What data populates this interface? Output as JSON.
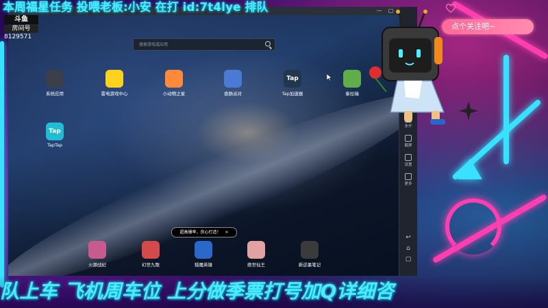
{
  "marquee_top": "本周福星任务 投喂老板:小安 在打 id:7t4lye  排队",
  "marquee_bottom": "队上车  飞机周车位  上分做季票打号加Q详细咨",
  "room": {
    "logo": "斗鱼",
    "label": "房间号",
    "number": "8129571"
  },
  "emulator": {
    "title": "",
    "search_placeholder": "搜索游戏或应用",
    "apps_top": [
      {
        "label": "系统应用",
        "icon": "grid-icon",
        "color": "#3a3f4a",
        "glyph": ""
      },
      {
        "label": "雷电游戏中心",
        "icon": "gamepad-icon",
        "color": "#ffd21f",
        "glyph": ""
      },
      {
        "label": "小动物之星",
        "icon": "fox-icon",
        "color": "#ff8a3c",
        "glyph": ""
      },
      {
        "label": "香肠派对",
        "icon": "character-icon",
        "color": "#4b7ad6",
        "glyph": ""
      },
      {
        "label": "Tap加速器",
        "icon": "tap-accelerator-icon",
        "color": "#22364e",
        "glyph": "Tap"
      },
      {
        "label": "泰拉瑞",
        "icon": "terraria-icon",
        "color": "#5fae4a",
        "glyph": ""
      }
    ],
    "apps_second": [
      {
        "label": "TapTap",
        "icon": "taptap-icon",
        "color": "#1fbcd2",
        "glyph": "Tap"
      }
    ],
    "apps_dock": [
      {
        "label": "火源战纪",
        "icon": "anime-girl-icon",
        "color": "#c75b8d"
      },
      {
        "label": "幻世九歌",
        "icon": "fantasy-icon",
        "color": "#d44a4a"
      },
      {
        "label": "猎魔英雄",
        "icon": "hero-icon",
        "color": "#2a69c9"
      },
      {
        "label": "绝世仙王",
        "icon": "immortal-icon",
        "color": "#e3a2a2"
      },
      {
        "label": "新逆墨笔记",
        "icon": "ink-notes-icon",
        "color": "#3b3b3b"
      }
    ],
    "toast": "超高爆率，良心打造！",
    "toast_close": "×",
    "sidebar": [
      {
        "label": "多开",
        "icon": "multi-window-icon"
      },
      {
        "label": "截屏",
        "icon": "screenshot-icon"
      },
      {
        "label": "设置",
        "icon": "settings-icon"
      },
      {
        "label": "更多",
        "icon": "more-icon"
      }
    ],
    "nav": [
      {
        "icon": "back-icon",
        "glyph": "↩"
      },
      {
        "icon": "home-icon",
        "glyph": "⌂"
      },
      {
        "icon": "recent-apps-icon",
        "glyph": "▢"
      }
    ]
  },
  "follow_badge": "点个关注吧~",
  "colors": {
    "neon_cyan": "#38e1ff",
    "neon_pink": "#ff3fb0",
    "badge_pink": "#ff6a98"
  }
}
